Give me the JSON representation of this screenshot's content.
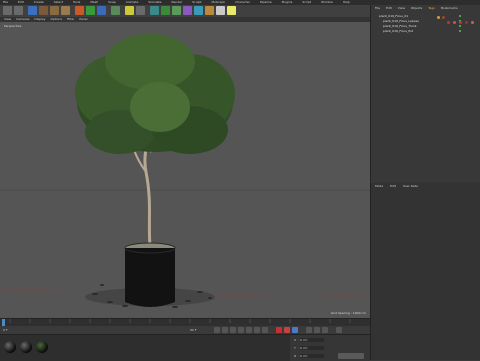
{
  "menubar": {
    "items": [
      "File",
      "Edit",
      "Create",
      "Select",
      "Tools",
      "Mesh",
      "Snap",
      "Animate",
      "Simulate",
      "Render",
      "Sculpt",
      "MoGraph",
      "Character",
      "Pipeline",
      "Plugins",
      "Script",
      "Window",
      "Help"
    ]
  },
  "viewport": {
    "menu_items": [
      "View",
      "Cameras",
      "Display",
      "Options",
      "Filter",
      "Panel"
    ],
    "camera_label": "Perspective",
    "grid_spacing": "Grid Spacing : 1000 cm"
  },
  "object_manager": {
    "menu_items": [
      "File",
      "Edit",
      "View",
      "Objects",
      "Tags",
      "Bookmarks"
    ],
    "objects": [
      {
        "name": "plant_019_Ficus_01",
        "color": "#58c058"
      },
      {
        "name": "plant_019_Ficus_Leaves",
        "color": "#58c058"
      },
      {
        "name": "plant_019_Ficus_Trunk",
        "color": "#58c058"
      },
      {
        "name": "plant_019_Ficus_Pot",
        "color": "#58c058"
      }
    ]
  },
  "attribute_manager": {
    "menu_items": [
      "Mode",
      "Edit",
      "User Data"
    ]
  },
  "timeline": {
    "frame": "0 F",
    "end_frame": "90 F"
  },
  "coordinates": {
    "labels": [
      "X",
      "Y",
      "Z"
    ],
    "values": [
      "0 cm",
      "0 cm",
      "0 cm"
    ]
  }
}
